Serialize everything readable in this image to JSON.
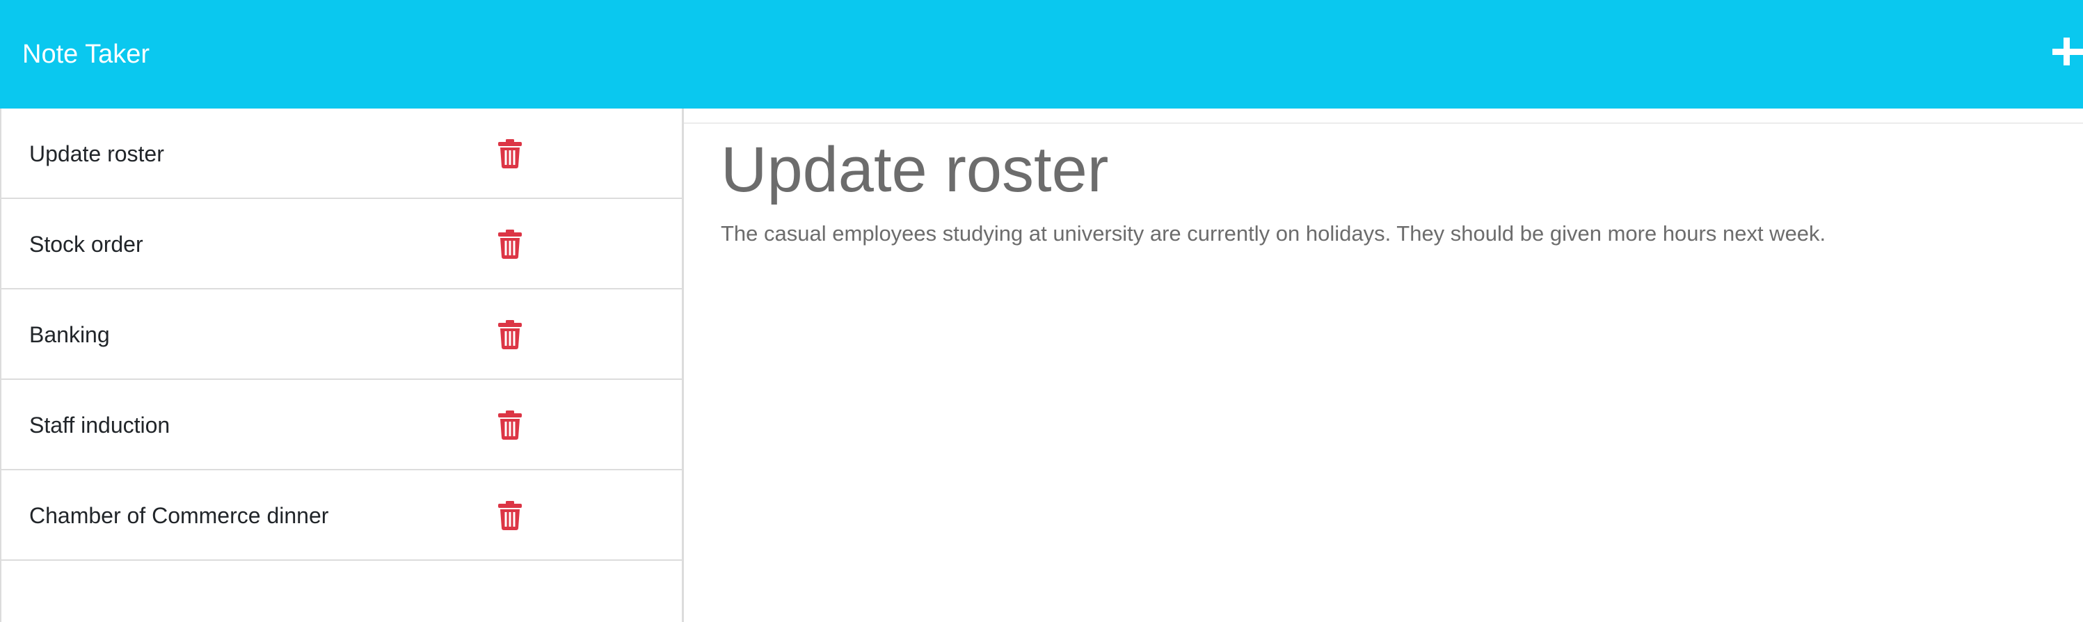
{
  "navbar": {
    "brand": "Note Taker",
    "new_note_icon": "plus-icon",
    "background_color": "#0ac8ef"
  },
  "notes_list": {
    "delete_icon": "trash-icon",
    "delete_icon_color": "#dc3545",
    "items": [
      {
        "title": "Update roster"
      },
      {
        "title": "Stock order"
      },
      {
        "title": "Banking"
      },
      {
        "title": "Staff induction"
      },
      {
        "title": "Chamber of Commerce dinner"
      }
    ]
  },
  "active_note": {
    "title": "Update roster",
    "text": "The casual employees studying at university are currently on holidays. They should be given more hours next week."
  }
}
